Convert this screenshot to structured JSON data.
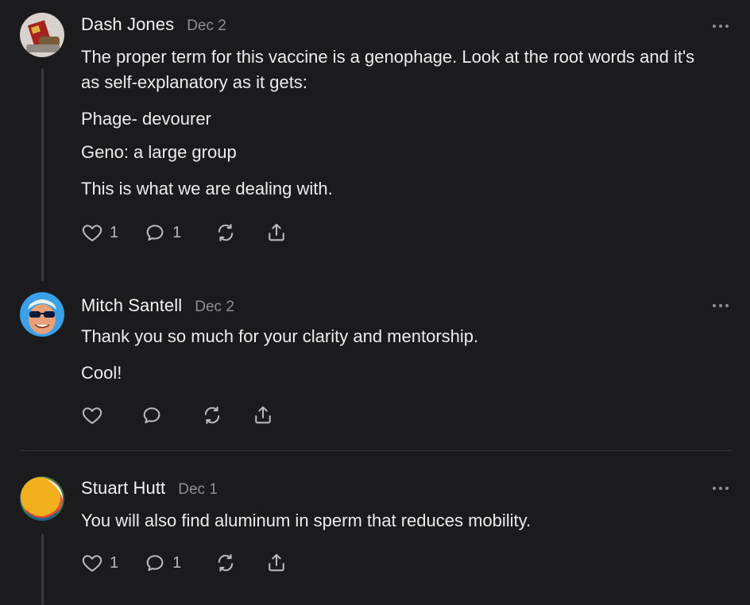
{
  "comments": [
    {
      "author": "Dash Jones",
      "date": "Dec 2",
      "paragraphs": [
        "The proper term for this vaccine is a genophage. Look at the root words and it's as self-explanatory as it gets:",
        "Phage- devourer",
        "Geno: a large group",
        "This is what we are dealing with."
      ],
      "like_count": "1",
      "reply_count": "1",
      "avatar_icon": "book-avatar"
    },
    {
      "author": "Mitch Santell",
      "date": "Dec 2",
      "paragraphs": [
        "Thank you so much for your clarity and mentorship.",
        "Cool!"
      ],
      "like_count": "",
      "reply_count": "",
      "avatar_icon": "person-sunglasses-avatar"
    },
    {
      "author": "Stuart Hutt",
      "date": "Dec 1",
      "paragraphs": [
        "You will also find aluminum in sperm that reduces mobility."
      ],
      "like_count": "1",
      "reply_count": "1",
      "avatar_icon": "circle-gradient-avatar"
    }
  ],
  "icons": {
    "like": "heart-icon",
    "reply": "comment-bubble-icon",
    "restack": "restack-icon",
    "share": "share-icon",
    "more": "more-dots-icon"
  },
  "colors": {
    "background": "#1b1b1d",
    "text": "#ececec",
    "muted": "#8e8e93",
    "icon": "#b8b8bc"
  }
}
